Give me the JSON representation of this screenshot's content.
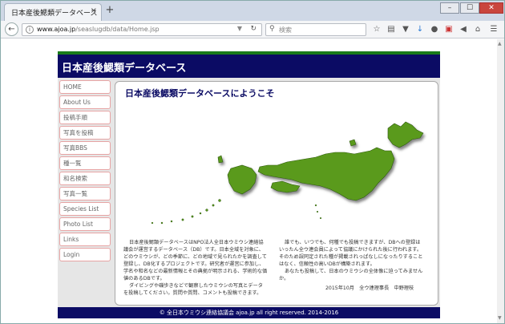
{
  "browser": {
    "tab_title": "日本産後鰓類データベース",
    "tab_close": "×",
    "new_tab": "+",
    "window_minimize": "–",
    "window_maximize": "☐",
    "window_close": "✕",
    "url_host": "www.ajoa.jp",
    "url_path": "/seaslugdb/data/Home.jsp",
    "search_placeholder": "検索"
  },
  "site": {
    "title": "日本産後鰓類データベース",
    "nav_items": [
      {
        "label": "HOME"
      },
      {
        "label": "About Us"
      },
      {
        "label": "投稿手順"
      },
      {
        "label": "写真を投稿"
      },
      {
        "label": "写真BBS"
      },
      {
        "label": "種一覧"
      },
      {
        "label": "和名検索"
      },
      {
        "label": "写真一覧"
      },
      {
        "label": "Species List"
      },
      {
        "label": "Photo List"
      },
      {
        "label": "Links"
      },
      {
        "label": "Login"
      }
    ],
    "welcome_title": "日本産後鰓類データベースにようこそ",
    "text_left_1": "日本産後鰓類データベースはNPO法人全日本ウミウシ連絡協議会が運営するデータベース（DB）です。日本全域を対象に、どのウミウシが、どの季節に、どの地域で見られたかを調査して登録し、DB化するプロジェクトです。研究者が運営に参加し、学名や和名などの最新情報とその典拠が明示される、学術的な価値のあるDBです。",
    "text_left_2": "ダイビングや磯歩きなどで観察したウミウシの写真とデータを投稿してください。質問や質問、コメントも投稿できます。",
    "text_right_1": "誰でも、いつでも、何種でも投稿できますが、DBへの登録はいったん全ウ連会員によって協議にかけられた後に行われます。そのため誤同定された種が掲載されっぱなしになったりすることはなく、信頼性の高いDBが構築されます。",
    "text_right_2": "あなたも投稿して、日本のウミウシの全体像に迫ってみませんか。",
    "signature": "2015年10月　全ウ連理事長　中野理枝",
    "footer": "© 全日本ウミウシ連絡協議会 ajoa.jp all right reserved. 2014-2016"
  },
  "colors": {
    "header_navy": "#0b0b64",
    "accent_green": "#1a7b1a",
    "map_green": "#5a9a1e",
    "nav_border": "#e7a4a4"
  }
}
